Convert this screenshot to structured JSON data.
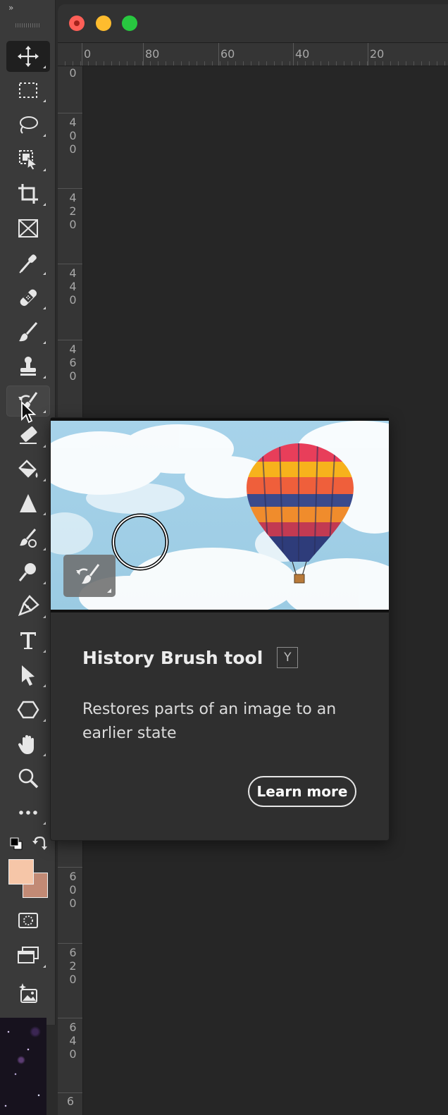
{
  "toolbar": {
    "collapse_label": "»",
    "tools": [
      {
        "name": "move-tool",
        "icon": "move-icon",
        "selected": true
      },
      {
        "name": "rectangular-marquee-tool",
        "icon": "marquee-icon"
      },
      {
        "name": "lasso-tool",
        "icon": "lasso-icon"
      },
      {
        "name": "object-selection-tool",
        "icon": "object-selection-icon"
      },
      {
        "name": "crop-tool",
        "icon": "crop-icon"
      },
      {
        "name": "frame-tool",
        "icon": "frame-icon"
      },
      {
        "name": "eyedropper-tool",
        "icon": "eyedropper-icon"
      },
      {
        "name": "spot-healing-tool",
        "icon": "bandage-icon"
      },
      {
        "name": "brush-tool",
        "icon": "brush-icon"
      },
      {
        "name": "clone-stamp-tool",
        "icon": "stamp-icon"
      },
      {
        "name": "history-brush-tool",
        "icon": "history-brush-icon",
        "hovered": true
      },
      {
        "name": "eraser-tool",
        "icon": "eraser-icon"
      },
      {
        "name": "paint-bucket-tool",
        "icon": "paint-bucket-icon"
      },
      {
        "name": "blur-tool",
        "icon": "blur-triangle-icon"
      },
      {
        "name": "sponge-tool",
        "icon": "sponge-icon"
      },
      {
        "name": "dodge-tool",
        "icon": "dodge-icon"
      },
      {
        "name": "pen-tool",
        "icon": "pen-icon"
      },
      {
        "name": "type-tool",
        "icon": "type-icon"
      },
      {
        "name": "path-selection-tool",
        "icon": "arrow-icon"
      },
      {
        "name": "shape-tool",
        "icon": "hexagon-icon"
      },
      {
        "name": "hand-tool",
        "icon": "hand-icon"
      },
      {
        "name": "zoom-tool",
        "icon": "zoom-icon"
      },
      {
        "name": "edit-toolbar",
        "icon": "more-icon"
      }
    ],
    "foreground_color": "#f6c6a8",
    "background_color": "#c28a75"
  },
  "document": {
    "ruler_top": [
      "0",
      "80",
      "60",
      "40",
      "20"
    ],
    "ruler_left": [
      "0",
      "400",
      "420",
      "440",
      "460",
      "600",
      "620",
      "640",
      "6"
    ]
  },
  "tooltip": {
    "title": "History Brush tool",
    "shortcut": "Y",
    "description": "Restores parts of an image to an earlier state",
    "learn_more": "Learn more"
  },
  "colors": {
    "toolbar_bg": "#3a3a3a",
    "canvas_bg": "#262626",
    "tooltip_bg": "#2f2f2f",
    "close": "#fe5f57",
    "minimize": "#febc2e",
    "maximize": "#28c840"
  }
}
